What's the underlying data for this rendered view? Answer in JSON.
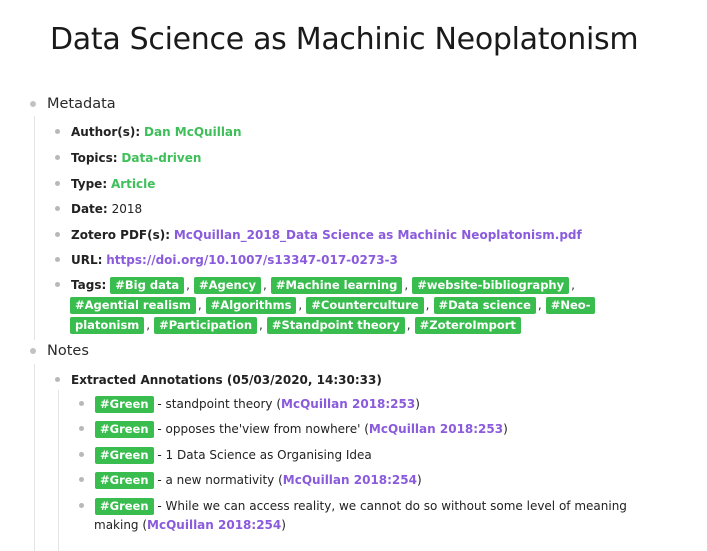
{
  "title": "Data Science as Machinic Neoplatonism",
  "metadata": {
    "heading": "Metadata",
    "author_key": "Author(s):",
    "author_val": "Dan McQuillan",
    "topics_key": "Topics:",
    "topics_val": "Data-driven",
    "type_key": "Type:",
    "type_val": "Article",
    "date_key": "Date:",
    "date_val": "2018",
    "pdf_key": "Zotero PDF(s):",
    "pdf_val": "McQuillan_2018_Data Science as Machinic Neoplatonism.pdf",
    "url_key": "URL:",
    "url_val": "https://doi.org/10.1007/s13347-017-0273-3",
    "tags_key": "Tags:",
    "tags": [
      "#Big data",
      "#Agency",
      "#Machine learning",
      "#website-bibliography",
      "#Agential realism",
      "#Algorithms",
      "#Counterculture",
      "#Data science",
      "#Neo-",
      "platonism",
      "#Participation",
      "#Standpoint theory",
      "#ZoteroImport"
    ]
  },
  "notes": {
    "heading": "Notes",
    "extracted": "Extracted Annotations (05/03/2020, 14:30:33)",
    "items": [
      {
        "tag": "#Green",
        "text": " - standpoint theory (",
        "cite": "McQuillan 2018:253",
        "close": ")"
      },
      {
        "tag": "#Green",
        "text": " - opposes the'view from nowhere' (",
        "cite": "McQuillan 2018:253",
        "close": ")"
      },
      {
        "tag": "#Green",
        "text": " - 1 Data Science as Organising Idea",
        "cite": "",
        "close": ""
      },
      {
        "tag": "#Green",
        "text": " - a new normativity (",
        "cite": "McQuillan 2018:254",
        "close": ")"
      },
      {
        "tag": "#Green",
        "text": " - While we can access reality, we cannot do so without some level of meaning",
        "cite": "",
        "close": ""
      }
    ],
    "last_cont_prefix": "making (",
    "last_cont_cite": "McQuillan 2018:254",
    "last_cont_close": ")"
  }
}
